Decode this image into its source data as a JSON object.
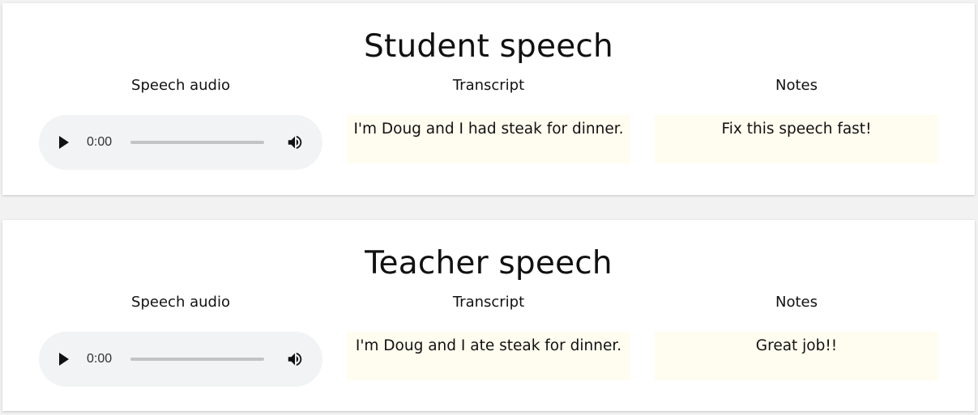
{
  "sections": [
    {
      "title": "Student speech",
      "audio": {
        "label": "Speech audio",
        "current_time": "0:00",
        "progress": 0,
        "icons": {
          "play": "play-icon",
          "volume": "volume-icon"
        }
      },
      "transcript": {
        "label": "Transcript",
        "text": "I'm Doug and I had steak for dinner."
      },
      "notes": {
        "label": "Notes",
        "text": "Fix this speech fast!"
      }
    },
    {
      "title": "Teacher speech",
      "audio": {
        "label": "Speech audio",
        "current_time": "0:00",
        "progress": 0,
        "icons": {
          "play": "play-icon",
          "volume": "volume-icon"
        }
      },
      "transcript": {
        "label": "Transcript",
        "text": "I'm Doug and I ate steak for dinner."
      },
      "notes": {
        "label": "Notes",
        "text": "Great job!!"
      }
    }
  ],
  "colors": {
    "page_background": "#f2f2f2",
    "card_background": "#ffffff",
    "player_background": "#f1f3f4",
    "text_box_background": "#fffdf0",
    "text": "#111111"
  }
}
